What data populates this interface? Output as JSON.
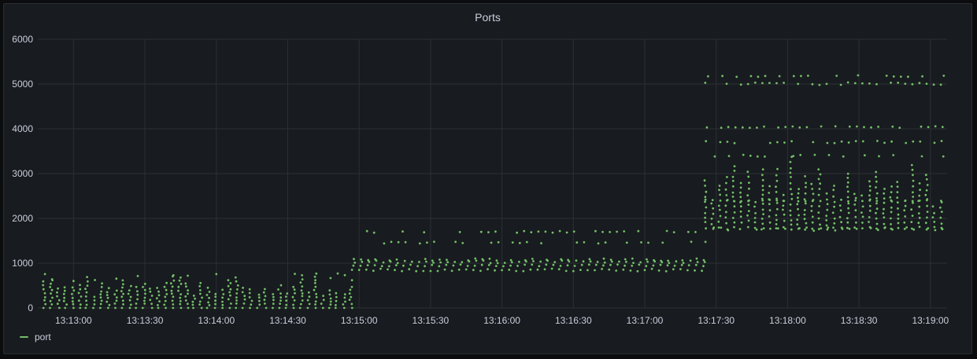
{
  "panel": {
    "title": "Ports"
  },
  "legend": {
    "series_name": "port",
    "color": "#73bf69"
  },
  "chart_data": {
    "type": "scatter",
    "title": "Ports",
    "xlabel": "",
    "ylabel": "",
    "x_tick_labels": [
      "13:13:00",
      "13:13:30",
      "13:14:00",
      "13:14:30",
      "13:15:00",
      "13:15:30",
      "13:16:00",
      "13:16:30",
      "13:17:00",
      "13:17:30",
      "13:18:00",
      "13:18:30",
      "13:19:00"
    ],
    "y_tick_labels": [
      "0",
      "1000",
      "2000",
      "3000",
      "4000",
      "5000",
      "6000"
    ],
    "x_range": [
      "13:12:45",
      "13:19:07"
    ],
    "ylim": [
      0,
      6000
    ],
    "grid": true,
    "legend_position": "bottom-left",
    "colors": {
      "series": "#73bf69",
      "grid": "#2c3035",
      "background": "#181b1f",
      "text": "#ccccdc"
    },
    "series": [
      {
        "name": "port",
        "phases": [
          {
            "from": "13:12:47",
            "to": "13:14:57",
            "period_s": 3.0,
            "levels": [
              0,
              100,
              200,
              300,
              400,
              500,
              600,
              780
            ],
            "note_range": [
              0,
              780
            ]
          },
          {
            "from": "13:14:57",
            "to": "13:17:25",
            "period_s": 3.0,
            "levels": [
              800,
              900,
              1000,
              1050,
              1100,
              1450,
              1700
            ],
            "note_range": [
              800,
              1700
            ]
          },
          {
            "from": "13:17:25",
            "to": "13:19:05",
            "period_s": 3.0,
            "levels": [
              1700,
              1800,
              2000,
              2400,
              2800,
              3100,
              3400,
              3700,
              4050,
              5000,
              5200
            ],
            "note_range": [
              1700,
              5200
            ]
          }
        ]
      }
    ]
  }
}
